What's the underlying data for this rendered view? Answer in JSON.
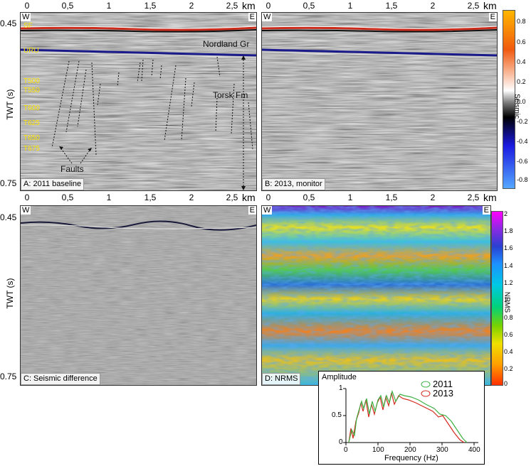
{
  "panels": {
    "a": {
      "label": "A: 2011 baseline"
    },
    "b": {
      "label": "B: 2013, monitor"
    },
    "c": {
      "label": "C: Seismic difference"
    },
    "d": {
      "label": "D: NRMS"
    }
  },
  "x_axis": {
    "ticks": [
      "0",
      "0,5",
      "1",
      "1,5",
      "2",
      "2,5"
    ],
    "unit": "km"
  },
  "y_axis": {
    "label": "TWT (s)",
    "top": "0.45",
    "bottom": "0.75"
  },
  "orientation": {
    "west": "W",
    "east": "E"
  },
  "horizons": [
    "SF",
    "URU",
    "T500",
    "T550",
    "T600",
    "T625",
    "T650",
    "T675"
  ],
  "annotations": {
    "nordland": "Nordland Gr",
    "torsk": "Torsk Fm",
    "faults": "Faults"
  },
  "colorbar_seismic": {
    "title": "Seismic",
    "ticks": [
      "0.8",
      "0.6",
      "0.4",
      "0.2",
      "0.0",
      "-0.2",
      "-0.4",
      "-0.6",
      "-0.8"
    ]
  },
  "colorbar_nrms": {
    "title": "NRMS",
    "ticks": [
      "2",
      "1.8",
      "1.6",
      "1.4",
      "1.2",
      "1",
      "0.8",
      "0.6",
      "0.4",
      "0.2",
      "0"
    ]
  },
  "inset": {
    "ylabel": "Amplitude",
    "xlabel": "Frequency (Hz)",
    "xticks": [
      "0",
      "100",
      "200",
      "300",
      "400"
    ],
    "yticks": [
      "1",
      "0.5",
      "0"
    ],
    "legend": [
      {
        "name": "2011",
        "color": "#3cb043"
      },
      {
        "name": "2013",
        "color": "#d42a1e"
      }
    ]
  }
}
